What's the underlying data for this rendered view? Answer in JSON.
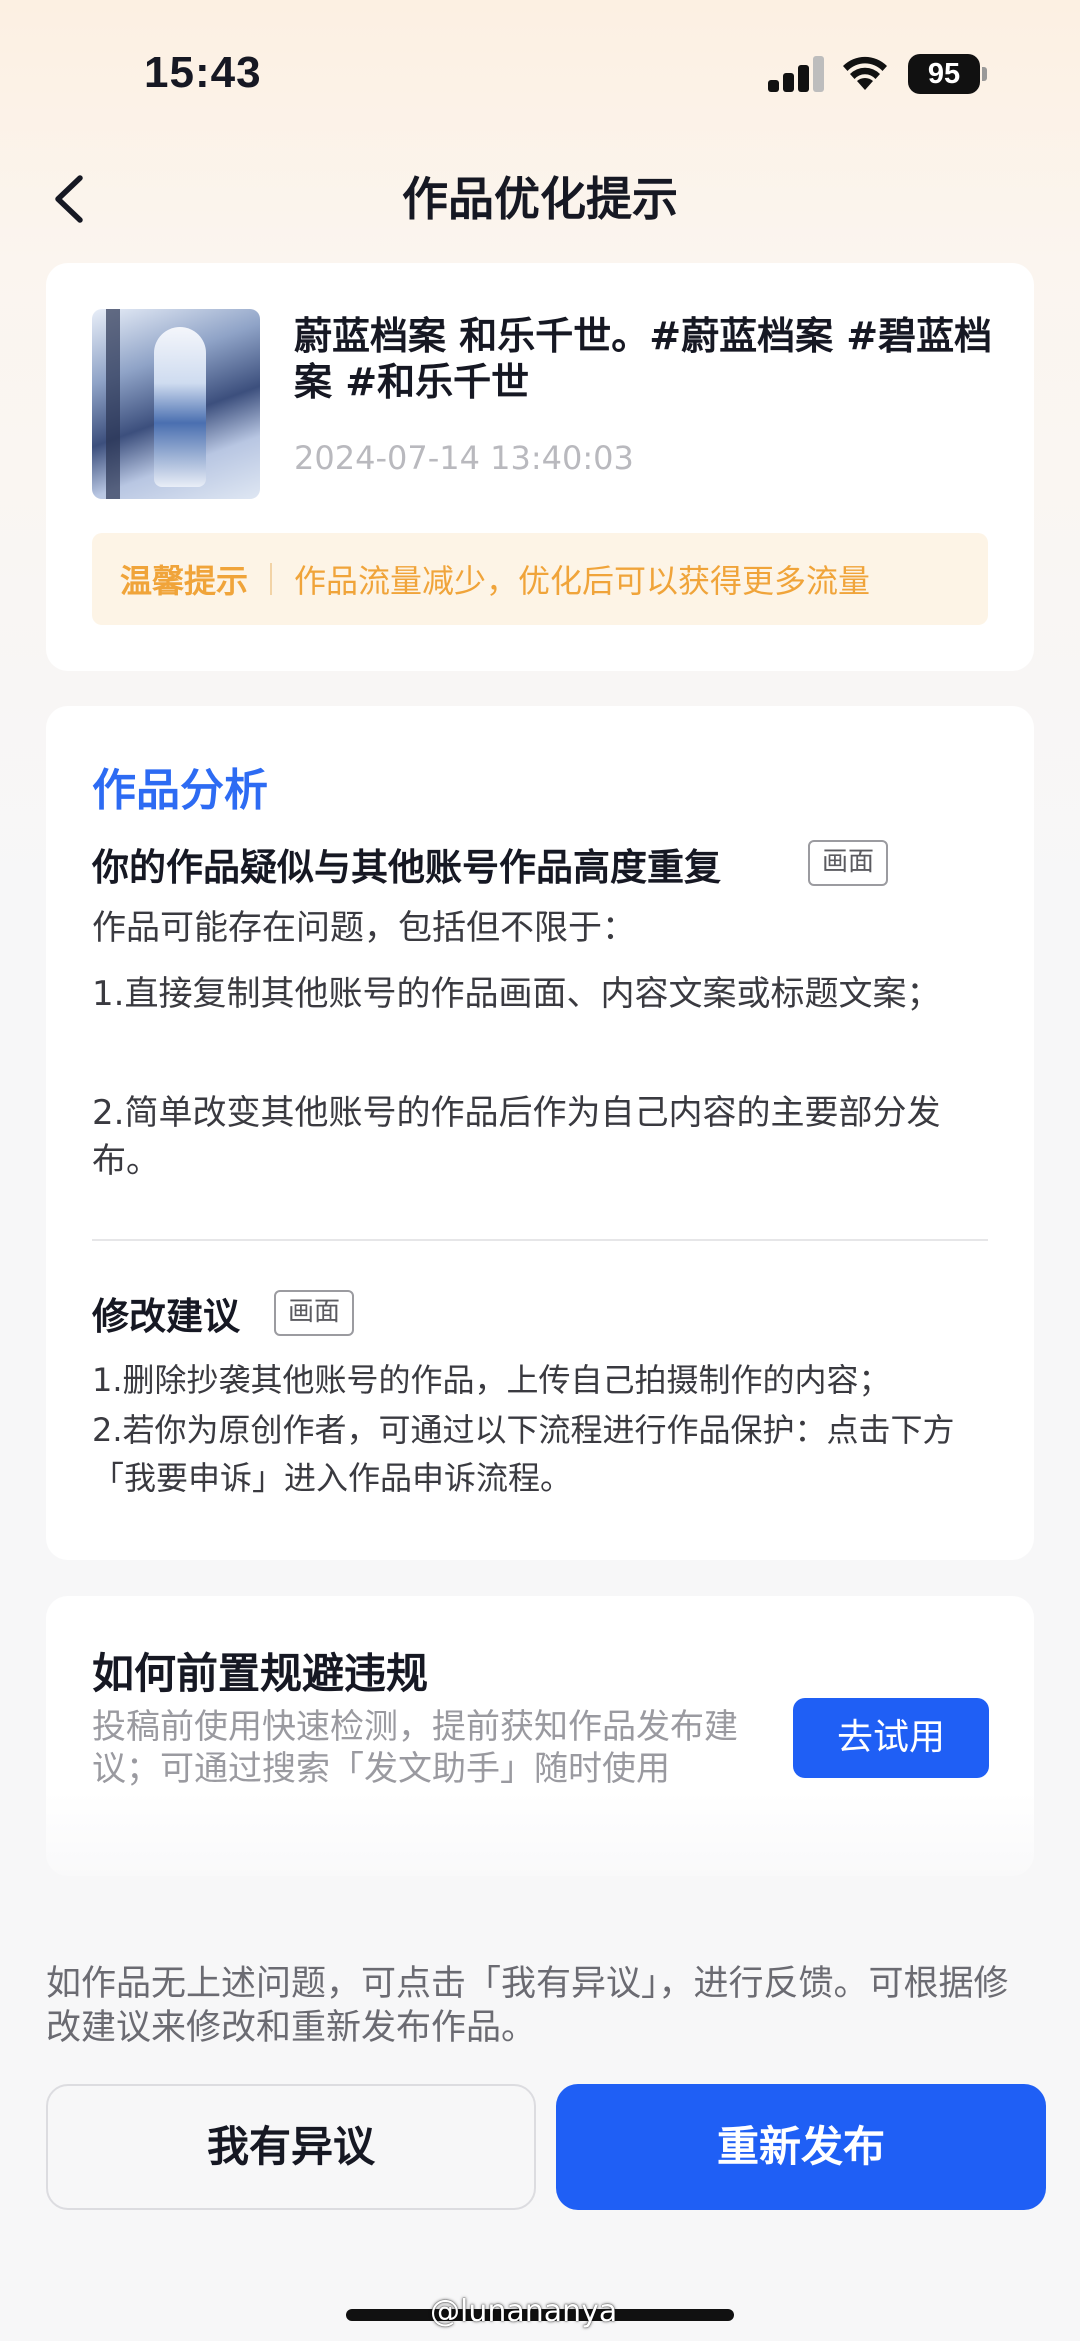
{
  "status_bar": {
    "time": "15:43",
    "battery": "95"
  },
  "nav": {
    "title": "作品优化提示"
  },
  "post": {
    "title": "蔚蓝档案 和乐千世。#蔚蓝档案 #碧蓝档案 #和乐千世",
    "date": "2024-07-14 13:40:03",
    "tip_label": "温馨提示",
    "tip_text": "作品流量减少，优化后可以获得更多流量"
  },
  "analysis": {
    "section_title": "作品分析",
    "issue_heading": "你的作品疑似与其他账号作品高度重复",
    "issue_tag": "画面",
    "intro": "作品可能存在问题，包括但不限于：",
    "items": [
      "1.直接复制其他账号的作品画面、内容文案或标题文案；",
      "2.简单改变其他账号的作品后作为自己内容的主要部分发布。"
    ],
    "suggestion_heading": "修改建议",
    "suggestion_tag": "画面",
    "suggestions": [
      "1.删除抄袭其他账号的作品，上传自己拍摄制作的内容；",
      "2.若你为原创作者，可通过以下流程进行作品保护：点击下方「我要申诉」进入作品申诉流程。"
    ]
  },
  "prevention": {
    "title": "如何前置规避违规",
    "description": "投稿前使用快速检测，提前获知作品发布建议；可通过搜索「发文助手」随时使用",
    "try_button": "去试用"
  },
  "footer": {
    "note": "如作品无上述问题，可点击「我有异议」，进行反馈。可根据修改建议来修改和重新发布作品。",
    "objection_button": "我有异议",
    "republish_button": "重新发布"
  },
  "watermark": "@lunananya",
  "colors": {
    "accent": "#1f5ff5",
    "tip": "#f0a43a",
    "section_title": "#2d6bf3"
  }
}
